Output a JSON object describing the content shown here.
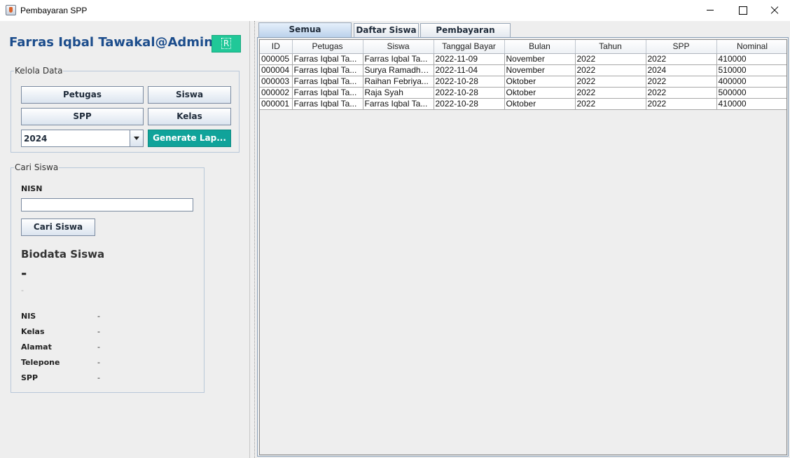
{
  "window": {
    "title": "Pembayaran SPP",
    "app_icon": "java-cup-icon"
  },
  "header": {
    "user_label": "Farras Iqbal Tawakal@Admin",
    "refresh_label": "R"
  },
  "kelola": {
    "legend": "Kelola Data",
    "petugas_label": "Petugas",
    "siswa_label": "Siswa",
    "spp_label": "SPP",
    "kelas_label": "Kelas",
    "year_selected": "2024",
    "generate_label": "Generate Lap..."
  },
  "cari": {
    "legend": "Cari Siswa",
    "nisn_label": "NISN",
    "nisn_value": "",
    "button_label": "Cari Siswa",
    "bio_title": "Biodata Siswa",
    "bio_name": "-",
    "bio_sub": "-",
    "rows": [
      {
        "label": "NIS",
        "value": "-"
      },
      {
        "label": "Kelas",
        "value": "-"
      },
      {
        "label": "Alamat",
        "value": "-"
      },
      {
        "label": "Telepone",
        "value": "-"
      },
      {
        "label": "SPP",
        "value": "-"
      }
    ]
  },
  "tabs": [
    {
      "label": "Semua Pembayaran",
      "active": true
    },
    {
      "label": "Daftar Siswa",
      "active": false
    },
    {
      "label": "Pembayaran Siswa",
      "active": false
    }
  ],
  "table": {
    "columns": [
      "ID",
      "Petugas",
      "Siswa",
      "Tanggal Bayar",
      "Bulan",
      "Tahun",
      "SPP",
      "Nominal"
    ],
    "rows": [
      [
        "000005",
        "Farras Iqbal Ta...",
        "Farras Iqbal Ta...",
        "2022-11-09",
        "November",
        "2022",
        "2022",
        "410000"
      ],
      [
        "000004",
        "Farras Iqbal Ta...",
        "Surya Ramadha...",
        "2022-11-04",
        "November",
        "2022",
        "2024",
        "510000"
      ],
      [
        "000003",
        "Farras Iqbal Ta...",
        "Raihan Febriya...",
        "2022-10-28",
        "Oktober",
        "2022",
        "2022",
        "400000"
      ],
      [
        "000002",
        "Farras Iqbal Ta...",
        "Raja Syah",
        "2022-10-28",
        "Oktober",
        "2022",
        "2022",
        "500000"
      ],
      [
        "000001",
        "Farras Iqbal Ta...",
        "Farras Iqbal Ta...",
        "2022-10-28",
        "Oktober",
        "2022",
        "2022",
        "410000"
      ]
    ]
  },
  "colors": {
    "title_blue": "#1c4d8c",
    "refresh_green": "#20c898",
    "generate_teal": "#10a39a"
  }
}
